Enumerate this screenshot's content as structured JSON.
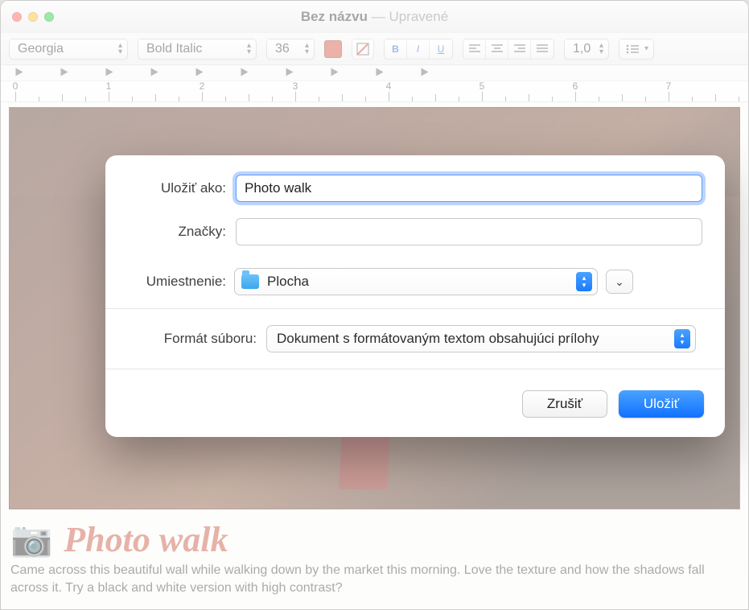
{
  "title": {
    "main": "Bez názvu",
    "sub": "Upravené"
  },
  "toolbar": {
    "font_family": "Georgia",
    "font_style": "Bold Italic",
    "font_size": "36",
    "swatch_color": "#d0553f",
    "line_height": "1,0"
  },
  "ruler": {
    "numbers": [
      "0",
      "1",
      "2",
      "3",
      "4",
      "5",
      "6",
      "7"
    ]
  },
  "document": {
    "emoji": "📷",
    "heading": "Photo walk",
    "body": "Came across this beautiful wall while walking down by the market this morning. Love the texture and how the shadows fall across it. Try a black and white version with high contrast?"
  },
  "dialog": {
    "save_as_label": "Uložiť ako:",
    "save_as_value": "Photo walk",
    "tags_label": "Značky:",
    "tags_value": "",
    "location_label": "Umiestnenie:",
    "location_value": "Plocha",
    "format_label": "Formát súboru:",
    "format_value": "Dokument s formátovaným textom obsahujúci prílohy",
    "cancel": "Zrušiť",
    "save": "Uložiť"
  }
}
